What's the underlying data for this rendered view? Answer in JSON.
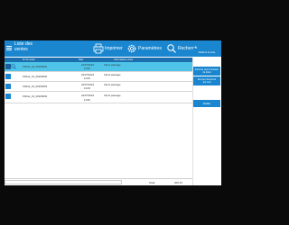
{
  "header": {
    "title_line1": "Liste des",
    "title_line2": "ventes",
    "print_label": "Imprimer",
    "settings_label": "Paramètres",
    "search_label": "Recherch"
  },
  "sidebar": {
    "btn1": "Détail de la vente",
    "btn2_line1": "Imprimer pour l'émission",
    "btn2_line2": "de ticket",
    "btn3_line1": "Envoyer document",
    "btn3_line2": "par mail",
    "btn4": "Modifier"
  },
  "table": {
    "headers": [
      "N° de vente",
      "Date",
      "Informations vente"
    ],
    "rows": [
      {
        "id": "FRA-E_01_00200001",
        "date": "24/07/2024",
        "time": "11:06",
        "info": "Client passage"
      },
      {
        "id": "FRA-E_01_00200002",
        "date": "24/07/2024",
        "time": "11:06",
        "info": "Client passage"
      },
      {
        "id": "FRA-E_01_00200003",
        "date": "24/07/2024",
        "time": "11:09",
        "info": "Client passage"
      },
      {
        "id": "FRA-E_01_00200004",
        "date": "24/07/2024",
        "time": "11:09",
        "info": "Client passage"
      }
    ]
  },
  "footer": {
    "total_label": "Total",
    "total_value": "205,67"
  },
  "colors": {
    "accent": "#1a86cf",
    "selected_row": "#4fc4e8",
    "background": "#0a0a0a"
  }
}
